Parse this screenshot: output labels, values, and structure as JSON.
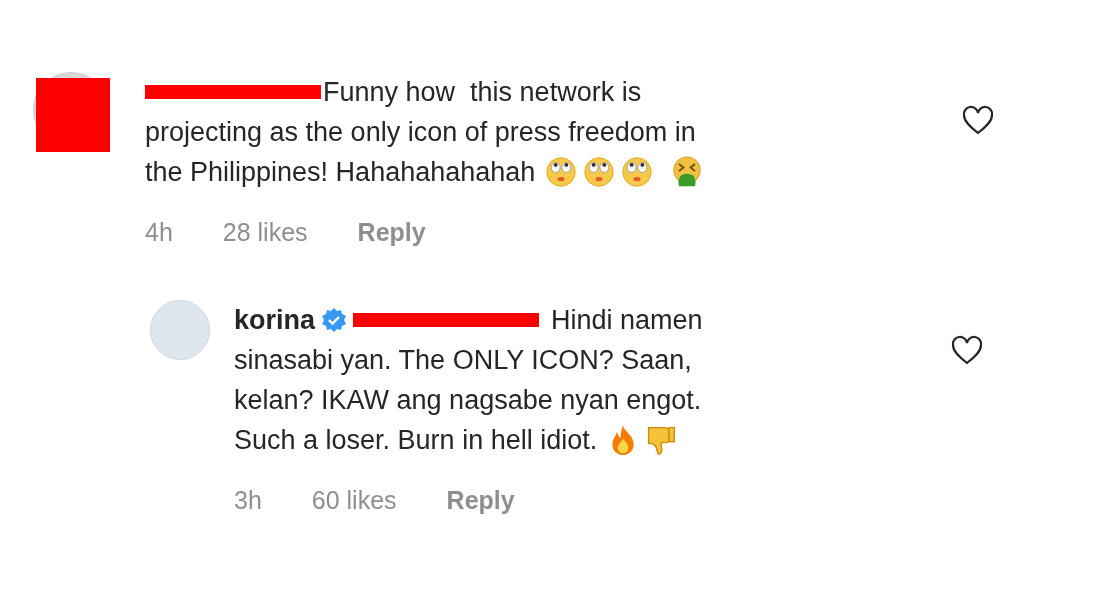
{
  "comments": [
    {
      "avatar_redacted": true,
      "username_redacted": true,
      "lines": [
        "Funny how  this network is",
        "projecting as the only icon of press freedom in",
        "the Philippines! Hahahahahahah"
      ],
      "emojis": [
        {
          "kind": "eye-roll"
        },
        {
          "kind": "eye-roll"
        },
        {
          "kind": "eye-roll"
        },
        {
          "kind": "vomit"
        }
      ],
      "time": "4h",
      "likes": "28 likes",
      "reply": "Reply",
      "liked": false,
      "replies": [
        {
          "username": "korina",
          "verified": true,
          "mention_redacted": true,
          "lines": [
            "Hindi namen",
            "sinasabi yan. The ONLY ICON? Saan,",
            "kelan? IKAW ang nagsabe nyan engot.",
            "Such a loser. Burn in hell idiot."
          ],
          "emojis": [
            {
              "kind": "fire"
            },
            {
              "kind": "thumbs-down"
            }
          ],
          "time": "3h",
          "likes": "60 likes",
          "reply": "Reply",
          "liked": false
        }
      ]
    }
  ]
}
